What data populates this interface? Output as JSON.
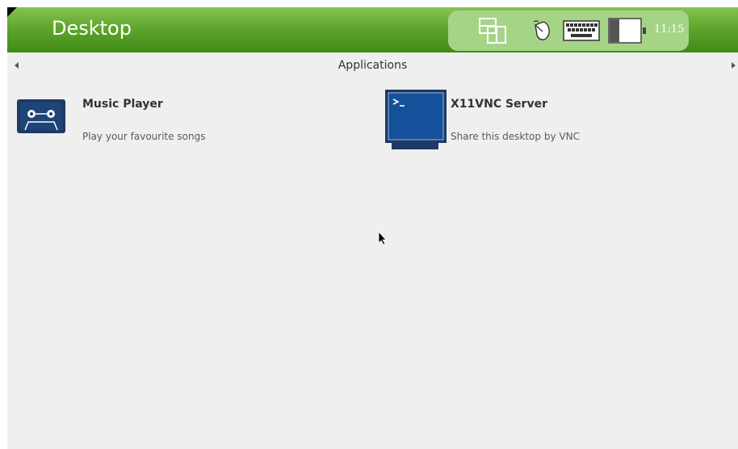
{
  "topbar": {
    "title": "Desktop",
    "clock": "11:15",
    "tray_icons": [
      "windows-icon",
      "mouse-icon",
      "keyboard-icon",
      "battery-icon"
    ]
  },
  "section": {
    "title": "Applications"
  },
  "apps": [
    {
      "name": "Music Player",
      "description": "Play your favourite songs",
      "icon": "cassette-icon"
    },
    {
      "name": "X11VNC Server",
      "description": "Share this desktop by VNC",
      "icon": "terminal-monitor-icon"
    }
  ],
  "colors": {
    "topbar_green": "#5fa62c",
    "tray_green": "#a6d487",
    "background": "#efefef",
    "icon_blue": "#1c3a66"
  }
}
